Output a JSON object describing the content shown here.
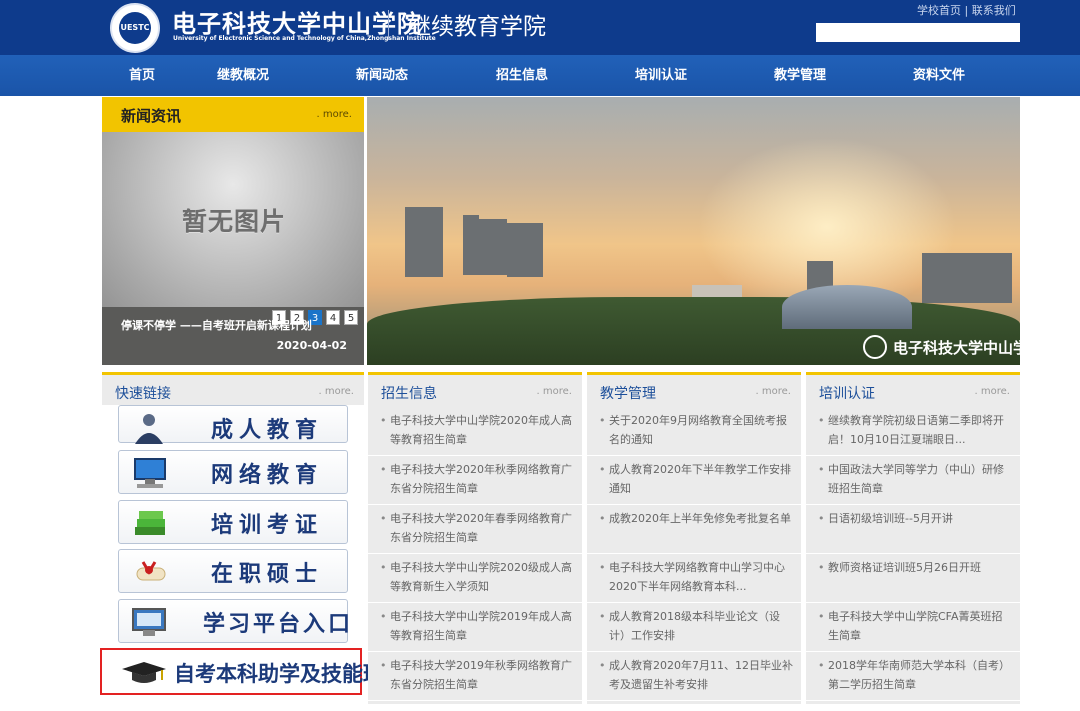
{
  "header": {
    "university_cn": "电子科技大学中山学院",
    "university_en": "University of Electronic Science and Technology of China,Zhongshan Institute",
    "logo_text": "UESTC",
    "college": "继续教育学院",
    "top_links": [
      "学校首页",
      "联系我们"
    ],
    "top_links_sep": "|",
    "search_placeholder": ""
  },
  "nav": [
    "首页",
    "继教概况",
    "新闻动态",
    "招生信息",
    "培训认证",
    "教学管理",
    "资料文件"
  ],
  "news": {
    "title": "新闻资讯",
    "more": ". more.",
    "image_text": "暂无图片",
    "pages": [
      "1",
      "2",
      "3",
      "4",
      "5"
    ],
    "active_page": "3",
    "caption": "停课不停学 ——自考班开启新课程计划",
    "date": "2020-04-02"
  },
  "banner": {
    "logo_text": "电子科技大学中山学院"
  },
  "quick_links": {
    "title": "快速链接",
    "more": ". more.",
    "items": [
      "成人教育",
      "网络教育",
      "培训考证",
      "在职硕士",
      "学习平台入口"
    ],
    "special": "自考本科助学及技能班"
  },
  "columns": [
    {
      "title": "招生信息",
      "more": ". more.",
      "items": [
        "电子科技大学中山学院2020年成人高等教育招生简章",
        "电子科技大学2020年秋季网络教育广东省分院招生简章",
        "电子科技大学2020年春季网络教育广东省分院招生简章",
        "电子科技大学中山学院2020级成人高等教育新生入学须知",
        "电子科技大学中山学院2019年成人高等教育招生简章",
        "电子科技大学2019年秋季网络教育广东省分院招生简章"
      ]
    },
    {
      "title": "教学管理",
      "more": ". more.",
      "items": [
        "关于2020年9月网络教育全国统考报名的通知",
        "成人教育2020年下半年教学工作安排通知",
        "成教2020年上半年免修免考批复名单",
        "电子科技大学网络教育中山学习中心2020下半年网络教育本科...",
        "成人教育2018级本科毕业论文（设计）工作安排",
        "成人教育2020年7月11、12日毕业补考及遗留生补考安排"
      ]
    },
    {
      "title": "培训认证",
      "more": ". more.",
      "items": [
        "继续教育学院初级日语第二季即将开启！10月10日江夏瑞眼日...",
        "中国政法大学同等学力（中山）研修班招生简章",
        "日语初级培训班--5月开讲",
        "教师资格证培训班5月26日开班",
        "电子科技大学中山学院CFA菁英班招生简章",
        "2018学年华南师范大学本科（自考）第二学历招生简章"
      ]
    }
  ]
}
